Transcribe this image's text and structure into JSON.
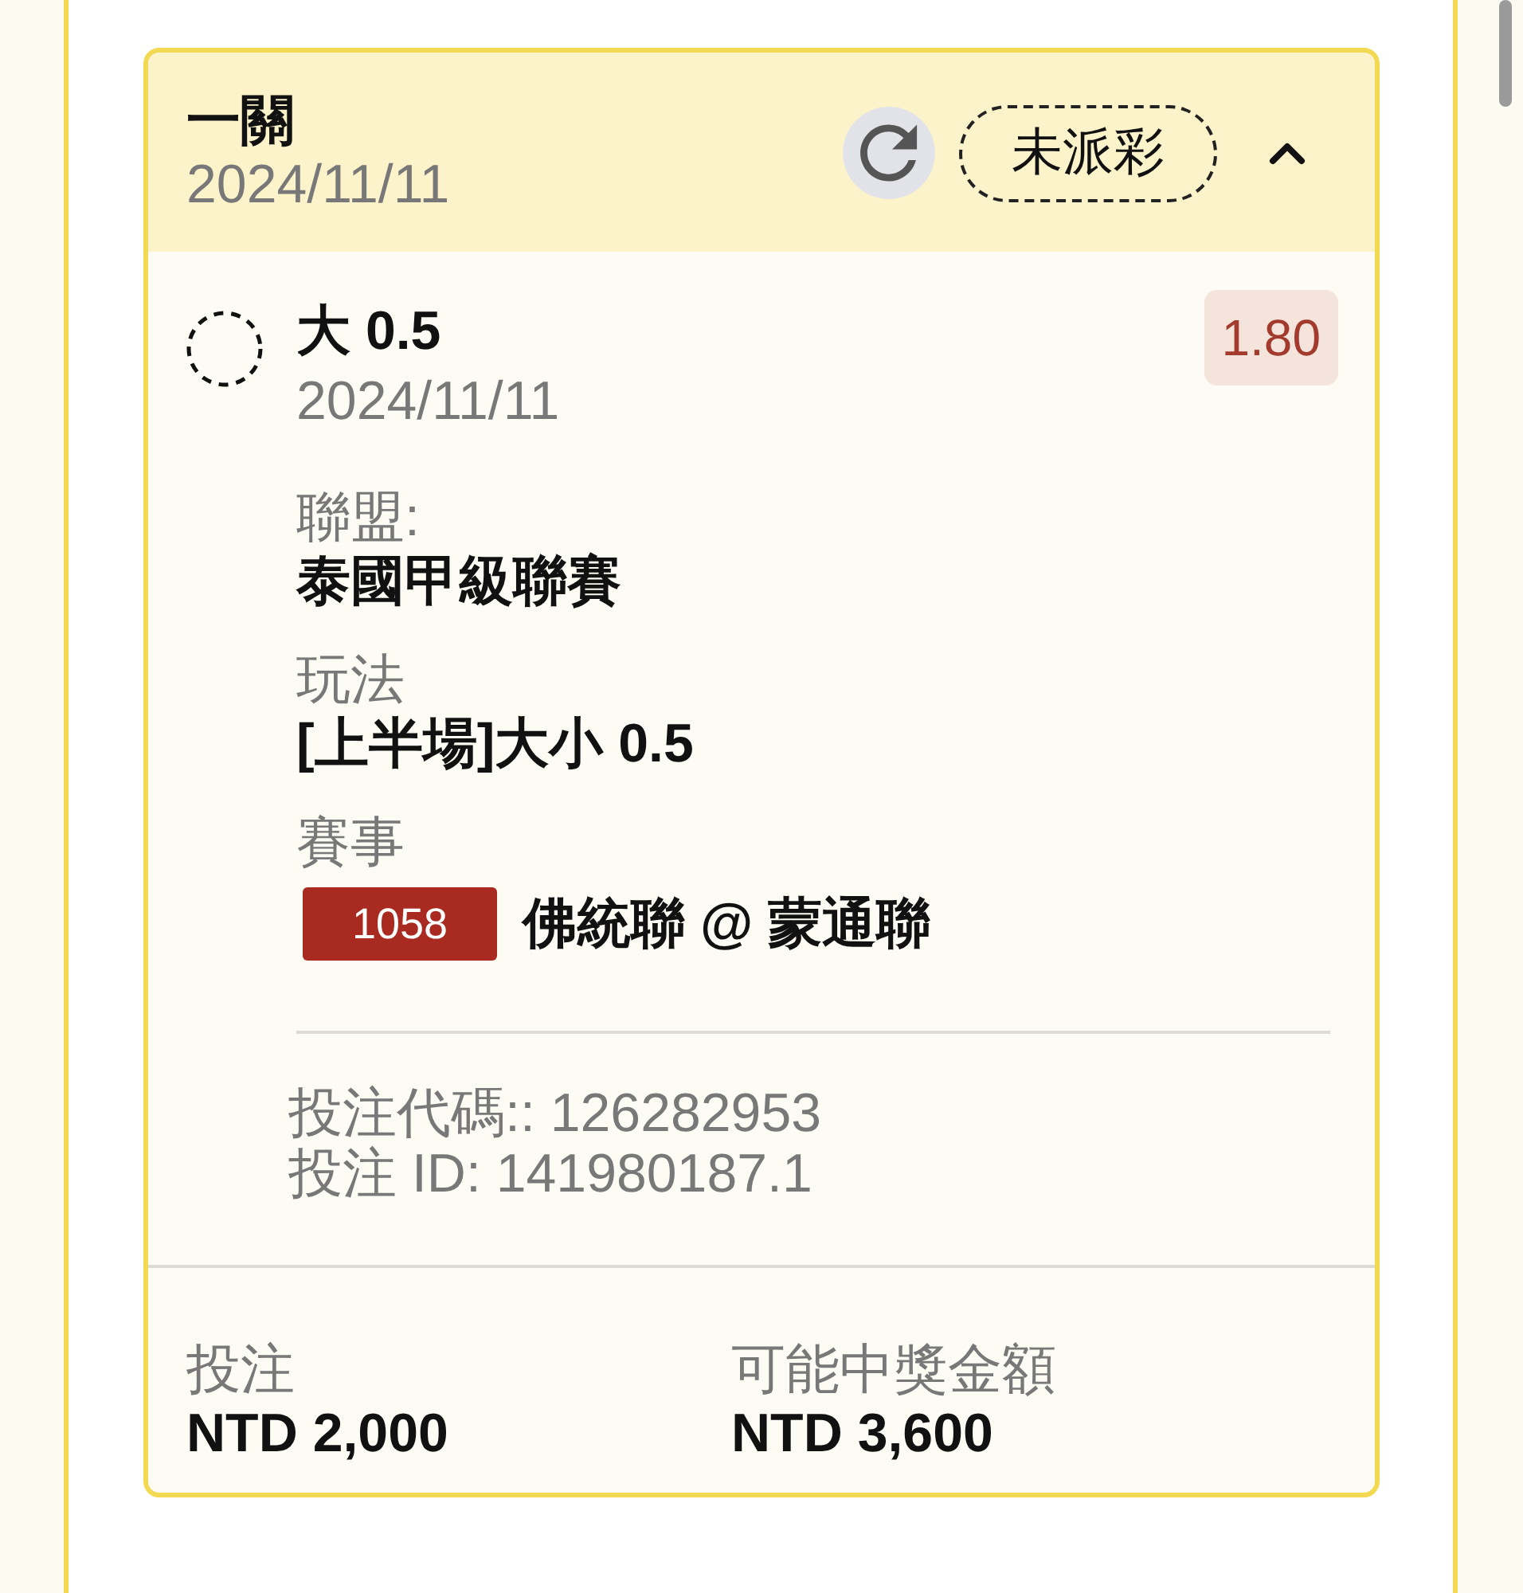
{
  "bet_card": {
    "title": "一關",
    "date": "2024/11/11",
    "status": "未派彩",
    "expanded": true,
    "selection": {
      "name": "大 0.5",
      "date": "2024/11/11",
      "odds": "1.80"
    },
    "fields": [
      {
        "kind": "text",
        "label": "聯盟:",
        "value": "泰國甲級聯賽"
      },
      {
        "kind": "text",
        "label": "玩法",
        "value": "[上半場]大小 0.5"
      },
      {
        "kind": "match",
        "label": "賽事",
        "match_number": "1058",
        "value": "佛統聯 @ 蒙通聯"
      }
    ],
    "references": [
      "投注代碼:: 126282953",
      "投注 ID: 141980187.1"
    ],
    "totals": [
      {
        "label": "投注",
        "value": "NTD 2,000"
      },
      {
        "label": "可能中獎金額",
        "value": "NTD 3,600"
      }
    ]
  }
}
